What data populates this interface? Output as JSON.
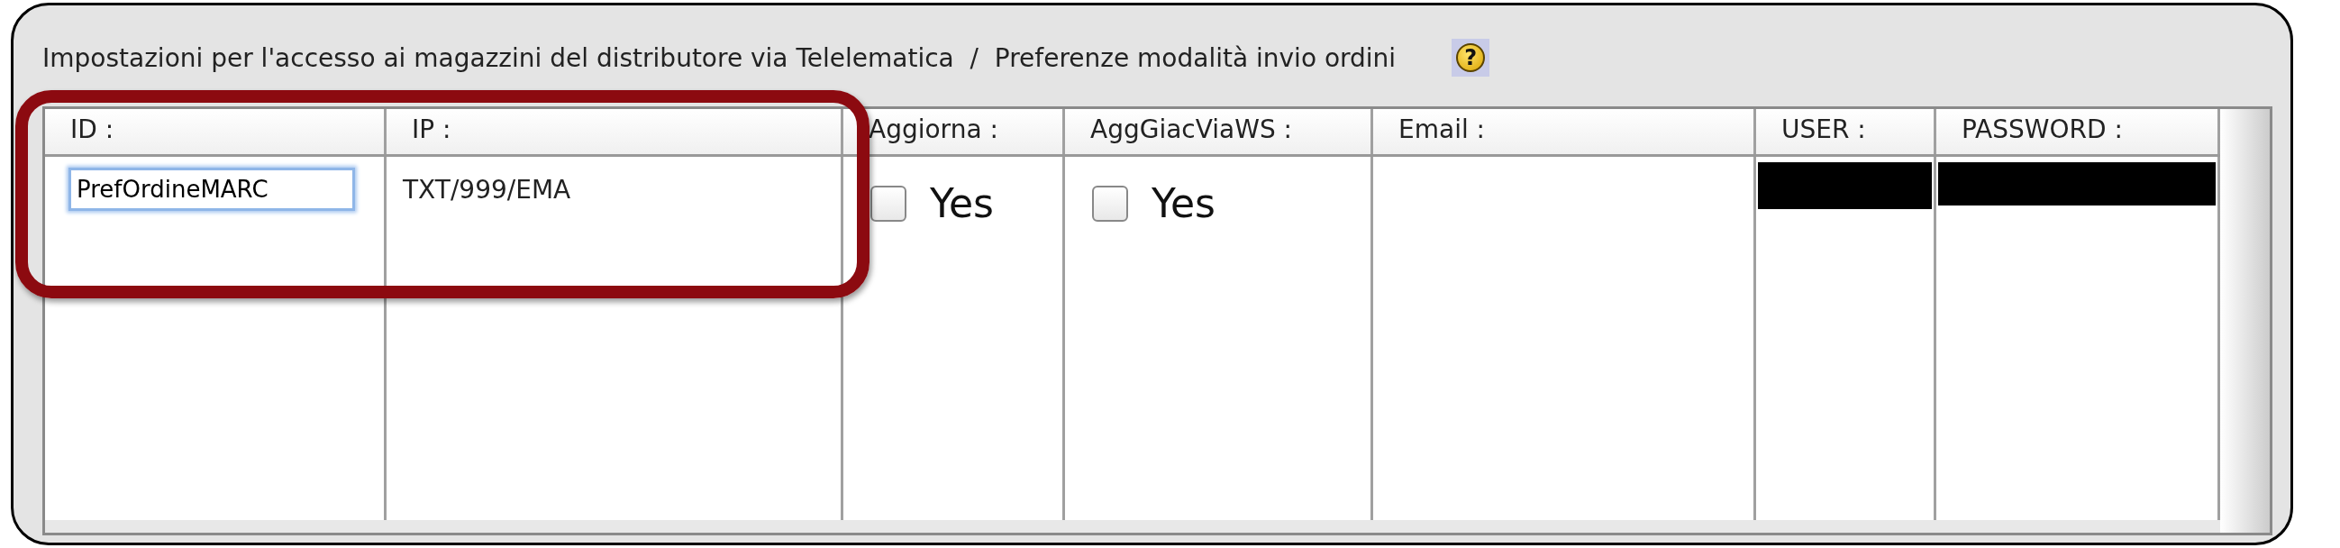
{
  "panel": {
    "title": "Impostazioni per l'accesso ai magazzini del distributore via Telelematica  /  Preferenze modalità invio ordini",
    "help": "?"
  },
  "table": {
    "columns": [
      "ID :",
      "IP :",
      "Aggiorna :",
      "AggGiacViaWS :",
      "Email :",
      "USER :",
      "PASSWORD :"
    ],
    "rows": [
      {
        "cells": [
          {
            "kind": "input",
            "value": "PrefOrdineMARC"
          },
          {
            "kind": "text",
            "value": "TXT/999/EMA"
          },
          {
            "kind": "checkbox",
            "label": "Yes",
            "checked": false
          },
          {
            "kind": "checkbox",
            "label": "Yes",
            "checked": false
          },
          {
            "kind": "empty"
          },
          {
            "kind": "redacted"
          },
          {
            "kind": "redacted"
          }
        ]
      }
    ]
  },
  "highlight": {
    "kind": "frame"
  }
}
